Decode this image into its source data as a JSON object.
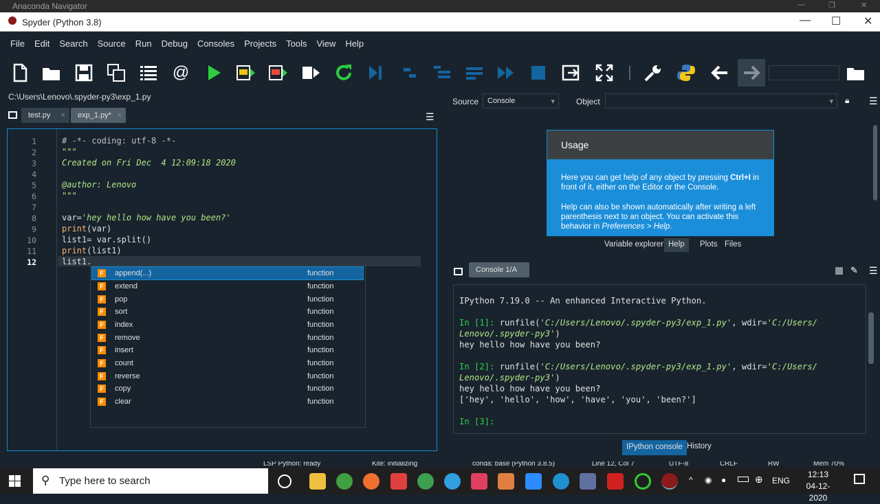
{
  "outer_window": {
    "title": "Anaconda Navigator"
  },
  "window": {
    "title": "Spyder (Python 3.8)",
    "min": "—",
    "max": "☐",
    "close": "✕"
  },
  "menu": [
    "File",
    "Edit",
    "Search",
    "Source",
    "Run",
    "Debug",
    "Consoles",
    "Projects",
    "Tools",
    "View",
    "Help"
  ],
  "editor": {
    "path": "C:\\Users\\Lenovo\\.spyder-py3\\exp_1.py",
    "tabs": [
      {
        "label": "test.py",
        "close": "×"
      },
      {
        "label": "exp_1.py*",
        "close": "×"
      }
    ],
    "line_numbers": [
      "1",
      "2",
      "3",
      "4",
      "5",
      "6",
      "7",
      "8",
      "9",
      "10",
      "11",
      "12"
    ],
    "lines": {
      "l1": "# -*- coding: utf-8 -*-",
      "l2": "\"\"\"",
      "l3": "Created on Fri Dec  4 12:09:18 2020",
      "l5": "@author: Lenovo",
      "l6": "\"\"\"",
      "l8a": "var=",
      "l8b": "'hey hello how have you been?'",
      "l9a": "print",
      "l9b": "(var)",
      "l10": "list1= var.split()",
      "l11a": "print",
      "l11b": "(list1)",
      "l12": "list1."
    }
  },
  "autocomplete": {
    "type_label": "function",
    "items": [
      "append(...)",
      "extend",
      "pop",
      "sort",
      "index",
      "remove",
      "insert",
      "count",
      "reverse",
      "copy",
      "clear"
    ]
  },
  "help": {
    "source_label": "Source",
    "source_value": "Console",
    "object_label": "Object",
    "usage_title": "Usage",
    "usage_p1a": "Here you can get help of any object by pressing ",
    "usage_p1b": "Ctrl+I",
    "usage_p1c": " in front of it, either on the Editor or the Console.",
    "usage_p2a": "Help can also be shown automatically after writing a left parenthesis next to an object. You can activate this behavior in ",
    "usage_p2b": "Preferences > Help",
    "usage_p2c": ".",
    "tabs": [
      "Variable explorer",
      "Help",
      "Plots",
      "Files"
    ]
  },
  "console": {
    "tab": "Console 1/A",
    "banner": "IPython 7.19.0 -- An enhanced Interactive Python.",
    "in1": "In [1]:",
    "run1a": " runfile(",
    "run1b": "'C:/Users/Lenovo/.spyder-py3/exp_1.py'",
    "run1c": ", wdir=",
    "run1d": "'C:/Users/",
    "run1e": "Lenovo/.spyder-py3'",
    "run1f": ")",
    "out1": "hey hello how have you been?",
    "in2": "In [2]:",
    "out2a": "hey hello how have you been?",
    "out2b": "['hey', 'hello', 'how', 'have', 'you', 'been?']",
    "in3": "In [3]:",
    "bottom_tabs": [
      "IPython console",
      "History"
    ]
  },
  "status": {
    "lsp": "LSP Python: ready",
    "kite": "Kite: initializing",
    "conda": "conda: base (Python 3.8.5)",
    "pos": "Line 12, Col 7",
    "enc": "UTF-8",
    "eol": "CRLF",
    "rw": "RW",
    "mem": "Mem 70%"
  },
  "taskbar": {
    "search_placeholder": "Type here to search",
    "lang": "ENG",
    "time": "12:13",
    "date": "04-12-2020"
  }
}
